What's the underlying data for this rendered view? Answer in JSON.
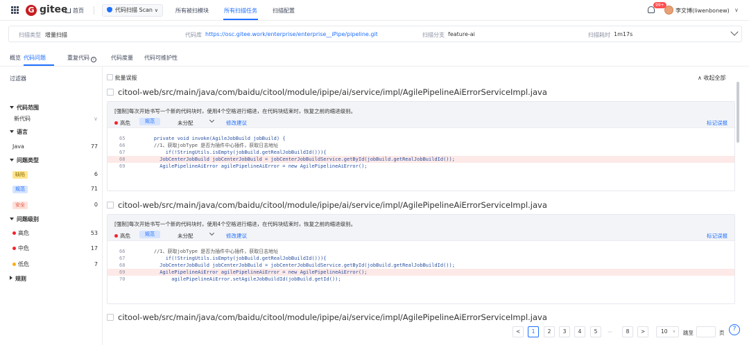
{
  "topbar": {
    "logo_letter": "G",
    "logo_text": "gitee",
    "home": "首页",
    "scan_dropdown": "代码扫描 Scan",
    "nav": [
      "所有被扫模块",
      "所有扫描任务",
      "扫描配置"
    ],
    "active_nav": "所有扫描任务",
    "badge": "99+",
    "username": "李文博(liwenbonew)"
  },
  "infobar": {
    "scan_type_label": "扫描类型",
    "scan_type": "增量扫描",
    "repo_label": "代码库",
    "repo": "https://osc.gitee.work/enterprise/enterprise__iPipe/pipeline.git",
    "branch_label": "扫描分支",
    "branch": "feature-ai",
    "duration_label": "扫描耗时",
    "duration": "1m17s"
  },
  "tabs": [
    "概览",
    "代码问题",
    "重复代码",
    "代码度量",
    "代码可维护性"
  ],
  "active_tab": "代码问题",
  "sidebar": {
    "title": "过滤器",
    "scope_head": "代码范围",
    "scope_value": "新代码",
    "lang_head": "语言",
    "lang": {
      "name": "Java",
      "count": "77"
    },
    "type_head": "问题类型",
    "types": [
      {
        "name": "缺陷",
        "count": "6"
      },
      {
        "name": "规范",
        "count": "71"
      },
      {
        "name": "安全",
        "count": "0"
      }
    ],
    "level_head": "问题级别",
    "levels": [
      {
        "name": "高危",
        "count": "53",
        "color": "#f5222d"
      },
      {
        "name": "中危",
        "count": "17",
        "color": "#f5222d"
      },
      {
        "name": "低危",
        "count": "7",
        "color": "#faad14"
      }
    ],
    "rules_head": "规则"
  },
  "main": {
    "batch_label": "批量误报",
    "collapse_label": "收起全部",
    "file_path": "citool-web/src/main/java/com/baidu/citool/module/ipipe/ai/service/impl/AgilePipelineAiErrorServiceImpl.java",
    "issues": [
      {
        "rule": "[强制]每次开始书写一个新的代码块时，使用4个空格进行缩进，在代码块结束时，恢复之前的缩进级别。",
        "severity": "高危",
        "category": "规范",
        "assign": "未分配",
        "fix": "修改建议",
        "mark": "标记误报"
      },
      {
        "rule": "[强制]每次开始书写一个新的代码块时，使用4个空格进行缩进，在代码块结束时，恢复之前的缩进级别。",
        "severity": "高危",
        "category": "规范",
        "assign": "未分配",
        "fix": "修改建议",
        "mark": "标记误报"
      }
    ],
    "code1": [
      {
        "n": "65",
        "t": "    private void invoke(AgileJobBuild jobBuild) {"
      },
      {
        "n": "66",
        "t": "    //1、获取jobType 是否为插件中心插件，获取日志地址"
      },
      {
        "n": "67",
        "t": "        if(!StringUtils.isEmpty(jobBuild.getRealJobBuildId())){"
      },
      {
        "n": "68",
        "t": "      JobCenterJobBuild jobCenterJobBuild = jobCenterJobBuildService.getById(jobBuild.getRealJobBuildId());"
      },
      {
        "n": "69",
        "t": "      AgilePipelineAiError agilePipelineAiError = new AgilePipelineAiError();"
      }
    ],
    "code2": [
      {
        "n": "66",
        "t": "    //1、获取jobType 是否为插件中心插件，获取日志地址"
      },
      {
        "n": "67",
        "t": "        if(!StringUtils.isEmpty(jobBuild.getRealJobBuildId())){"
      },
      {
        "n": "68",
        "t": "      JobCenterJobBuild jobCenterJobBuild = jobCenterJobBuildService.getById(jobBuild.getRealJobBuildId());"
      },
      {
        "n": "69",
        "t": "      AgilePipelineAiError agilePipelineAiError = new AgilePipelineAiError();"
      },
      {
        "n": "70",
        "t": "          agilePipelineAiError.setAgileJobBuildId(jobBuild.getId());"
      }
    ]
  },
  "pagination": {
    "prev": "<",
    "pages": [
      "1",
      "2",
      "3",
      "4",
      "5",
      "···",
      "8"
    ],
    "active": "1",
    "next": ">",
    "page_size": "10",
    "jump_label": "跳至",
    "page_unit": "页"
  },
  "help": "?"
}
